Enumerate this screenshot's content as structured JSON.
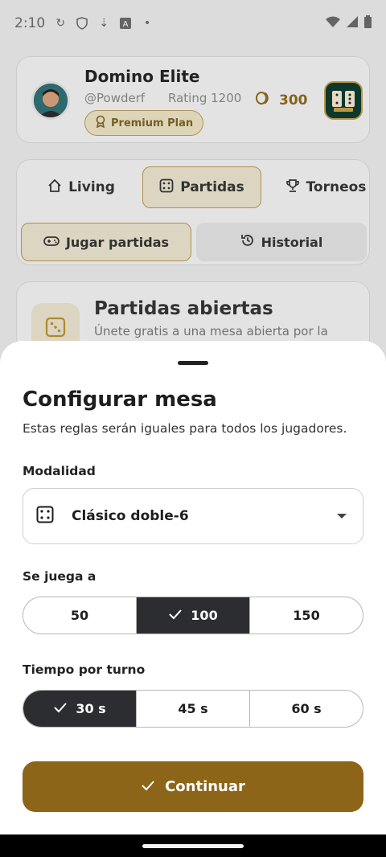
{
  "status_bar": {
    "time": "2:10"
  },
  "profile": {
    "app_name": "Domino Elite",
    "handle": "@Powderf",
    "rating": "Rating 1200",
    "plan": "Premium Plan",
    "coins": "300"
  },
  "tabs": [
    {
      "label": "Living",
      "icon": "home-icon"
    },
    {
      "label": "Partidas",
      "icon": "dice-icon"
    },
    {
      "label": "Torneos",
      "icon": "trophy-icon"
    }
  ],
  "subtabs": [
    {
      "label": "Jugar partidas",
      "icon": "gamepad-icon"
    },
    {
      "label": "Historial",
      "icon": "history-icon"
    }
  ],
  "open_games": {
    "title": "Partidas abiertas",
    "description": "Únete gratis a una mesa abierta por la"
  },
  "sheet": {
    "title": "Configurar mesa",
    "subtitle": "Estas reglas serán iguales para todos los jugadores.",
    "modalidad": {
      "label": "Modalidad",
      "value": "Clásico doble-6"
    },
    "points": {
      "label": "Se juega a",
      "options": [
        "50",
        "100",
        "150"
      ],
      "selected": "100"
    },
    "turn_time": {
      "label": "Tiempo por turno",
      "options": [
        "30 s",
        "45 s",
        "60 s"
      ],
      "selected": "30 s"
    },
    "cta": "Continuar"
  },
  "colors": {
    "accent": "#8c6518",
    "selected_segment": "#2b2d31",
    "badge": "#eee3c4"
  }
}
